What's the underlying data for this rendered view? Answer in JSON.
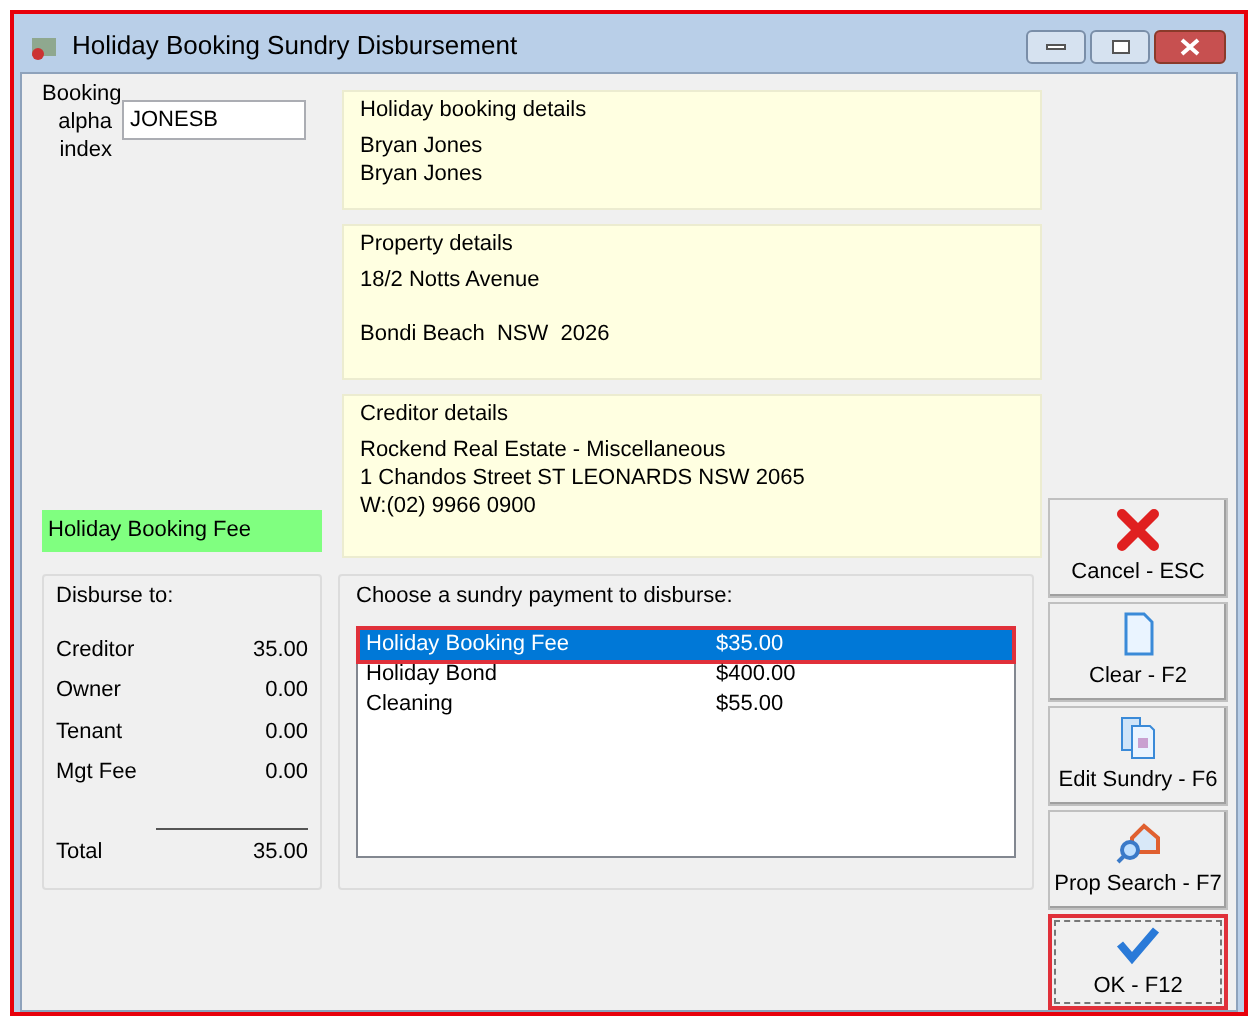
{
  "window": {
    "title": "Holiday Booking Sundry Disbursement"
  },
  "booking": {
    "label": "Booking alpha index",
    "value": "JONESB"
  },
  "panels": [
    {
      "title": "Holiday booking details",
      "lines": [
        "Bryan Jones",
        "Bryan Jones"
      ]
    },
    {
      "title": "Property details",
      "lines": [
        "18/2 Notts Avenue",
        "Bondi Beach  NSW  2026"
      ],
      "spaced": true
    },
    {
      "title": "Creditor details",
      "lines": [
        "Rockend Real Estate - Miscellaneous",
        "1 Chandos Street ST LEONARDS NSW 2065",
        "W:(02) 9966 0900"
      ]
    }
  ],
  "selected_sundry_label": "Holiday Booking Fee",
  "disburse": {
    "title": "Disburse to:",
    "rows": [
      {
        "label": "Creditor",
        "amount": "35.00"
      },
      {
        "label": "Owner",
        "amount": "0.00"
      },
      {
        "label": "Tenant",
        "amount": "0.00"
      },
      {
        "label": "Mgt Fee",
        "amount": "0.00"
      }
    ],
    "total_label": "Total",
    "total": "35.00"
  },
  "sundries": {
    "title": "Choose a sundry payment to disburse:",
    "items": [
      {
        "name": "Holiday Booking Fee",
        "amount": "$35.00",
        "selected": true
      },
      {
        "name": "Holiday Bond",
        "amount": "$400.00",
        "selected": false
      },
      {
        "name": "Cleaning",
        "amount": "$55.00",
        "selected": false
      }
    ]
  },
  "buttons": [
    {
      "kind": "cancel",
      "label": "Cancel - ESC",
      "focused": false
    },
    {
      "kind": "clear",
      "label": "Clear - F2",
      "focused": false
    },
    {
      "kind": "edit",
      "label": "Edit Sundry - F6",
      "focused": false
    },
    {
      "kind": "search",
      "label": "Prop Search - F7",
      "focused": false
    },
    {
      "kind": "ok",
      "label": "OK - F12",
      "focused": true
    }
  ]
}
